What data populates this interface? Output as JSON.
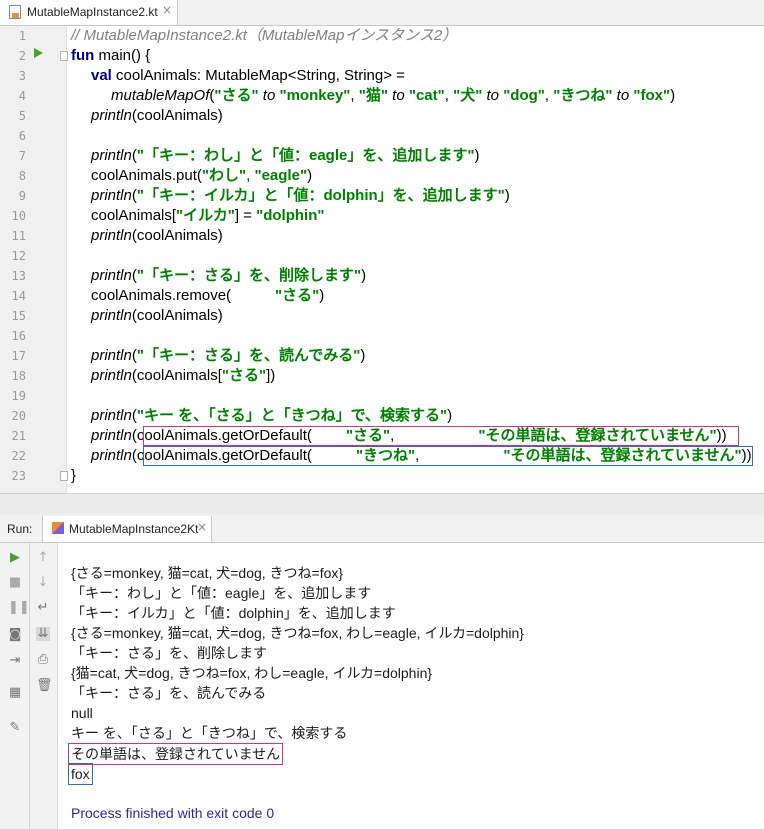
{
  "file_tab": {
    "label": "MutableMapInstance2.kt",
    "close": "×"
  },
  "code": {
    "line_numbers": [
      "1",
      "2",
      "3",
      "4",
      "5",
      "6",
      "7",
      "8",
      "9",
      "10",
      "11",
      "12",
      "13",
      "14",
      "15",
      "16",
      "17",
      "18",
      "19",
      "20",
      "21",
      "22",
      "23"
    ],
    "l1": "// MutableMapInstance2.kt（MutableMapインスタンス2）",
    "l2_kw": "fun",
    "l2_rest": " main() {",
    "l3_kw": "val",
    "l3_rest": " coolAnimals: MutableMap<String, String> =",
    "l4": {
      "fn": "mutableMapOf",
      "p1": "(",
      "s1": "\"さる\"",
      "to1": " to ",
      "s2": "\"monkey\"",
      "c1": ", ",
      "s3": "\"猫\"",
      "to2": " to ",
      "s4": "\"cat\"",
      "c2": ", ",
      "s5": "\"犬\"",
      "to3": " to ",
      "s6": "\"dog\"",
      "c3": ", ",
      "s7": "\"きつね\"",
      "to4": " to ",
      "s8": "\"fox\"",
      "p2": ")"
    },
    "println": "println",
    "l5_rest": "(coolAnimals)",
    "l7_str": "\"「キー：わし」と「値：eagle」を、追加します\"",
    "l8_a": "coolAnimals.put(",
    "l8_s1": "\"わし\"",
    "l8_c": ", ",
    "l8_s2": "\"eagle\"",
    "l8_b": ")",
    "l9_str": "\"「キー：イルカ」と「値：dolphin」を、追加します\"",
    "l10_a": "coolAnimals[",
    "l10_s1": "\"イルカ\"",
    "l10_b": "] = ",
    "l10_s2": "\"dolphin\"",
    "l13_str": "\"「キー：さる」を、削除します\"",
    "l14_a": "coolAnimals.remove(",
    "l14_s": "\"さる\"",
    "l14_b": ")",
    "l16_str": "\"「キー：さる」を、読んでみる\"",
    "l18_a": "(coolAnimals[",
    "l18_s": "\"さる\"",
    "l18_b": "])",
    "l20_str": "\"キー を、「さる」と「きつね」で、検索する\"",
    "l21_a": "coolAnimals.getOrDefault(",
    "l21_s1": "\"さる\"",
    "l21_c": ",",
    "l21_s2": "\"その単語は、登録されていません\"",
    "l21_b": "))",
    "l22_s1": "\"きつね\"",
    "open_paren": "(",
    "close_paren": ")",
    "brace_close": "}"
  },
  "run_panel": {
    "label": "Run:",
    "tab_title": "MutableMapInstance2Kt",
    "close": "×",
    "output": [
      "{さる=monkey, 猫=cat, 犬=dog, きつね=fox}",
      "「キー：わし」と「値：eagle」を、追加します",
      "「キー：イルカ」と「値：dolphin」を、追加します",
      "{さる=monkey, 猫=cat, 犬=dog, きつね=fox, わし=eagle, イルカ=dolphin}",
      "「キー：さる」を、削除します",
      "{猫=cat, 犬=dog, きつね=fox, わし=eagle, イルカ=dolphin}",
      "「キー：さる」を、読んでみる",
      "null",
      "キー を、「さる」と「きつね」で、検索する",
      "その単語は、登録されていません",
      "fox",
      "",
      "Process finished with exit code 0"
    ]
  },
  "colors": {
    "keyword": "#000080",
    "string": "#008000",
    "comment": "#808080",
    "highlight_pink": "#d6347a",
    "highlight_blue": "#2d6db4",
    "run_green": "#4aa02c"
  },
  "icons": [
    "file-kotlin-icon",
    "run-gutter-icon",
    "fold-icon",
    "kotlin-run-icon",
    "rerun-icon",
    "stop-icon",
    "pause-icon",
    "camera-icon",
    "exit-icon",
    "layout-icon",
    "pin-icon",
    "up-arrow-icon",
    "down-arrow-icon",
    "soft-wrap-icon",
    "scroll-end-icon",
    "print-icon",
    "trash-icon"
  ]
}
